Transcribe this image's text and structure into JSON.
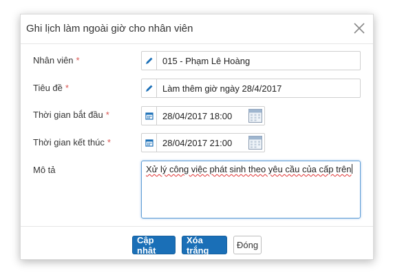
{
  "dialog": {
    "title": "Ghi lịch làm ngoài giờ cho nhân viên",
    "close_icon": "close-icon"
  },
  "form": {
    "employee": {
      "label": "Nhân viên",
      "required": "*",
      "value": "015 - Phạm Lê Hoàng",
      "icon": "pencil-icon"
    },
    "subject": {
      "label": "Tiêu đề",
      "required": "*",
      "value": "Làm thêm giờ ngày 28/4/2017",
      "icon": "pencil-icon"
    },
    "start_time": {
      "label": "Thời gian bắt đầu",
      "required": "*",
      "value": "28/04/2017 18:00",
      "icon": "calendar-icon"
    },
    "end_time": {
      "label": "Thời gian kết thúc",
      "required": "*",
      "value": "28/04/2017 21:00",
      "icon": "calendar-icon"
    },
    "description": {
      "label": "Mô tả",
      "value": "Xử lý công việc phát sinh theo yêu cầu của cấp trên"
    }
  },
  "footer": {
    "update_label": "Cập nhật",
    "clear_label": "Xóa trắng",
    "close_label": "Đóng"
  },
  "colors": {
    "primary": "#1a6fb7",
    "required": "#d9534f",
    "icon": "#1a6fb7"
  }
}
